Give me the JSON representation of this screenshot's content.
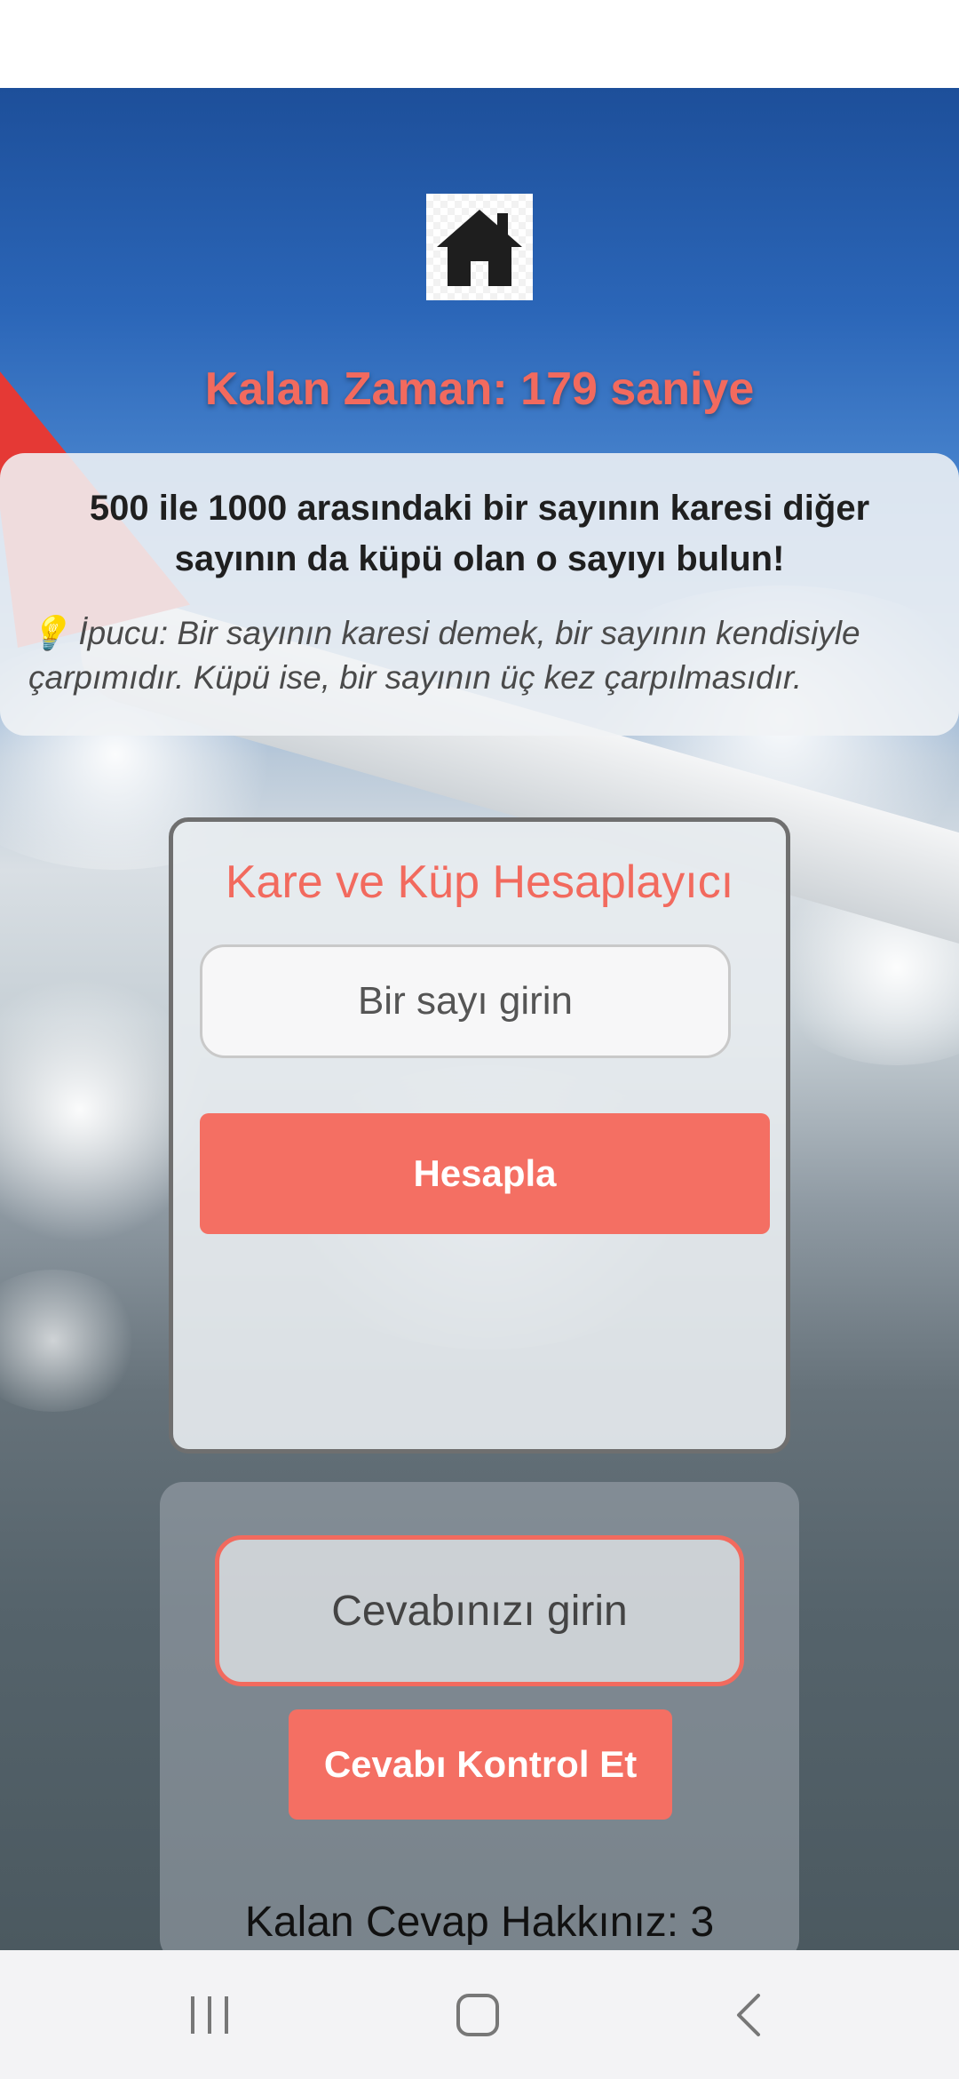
{
  "header": {
    "timer_text": "Kalan Zaman: 179 saniye"
  },
  "question": {
    "text": "500 ile 1000 arasındaki bir sayının karesi diğer sayının da küpü olan o sayıyı bulun!",
    "hint_icon": "💡",
    "hint": "İpucu: Bir sayının karesi demek, bir sayının kendisiyle çarpımıdır. Küpü ise, bir sayının üç kez çarpılmasıdır."
  },
  "calculator": {
    "title": "Kare ve Küp Hesaplayıcı",
    "input_placeholder": "Bir sayı girin",
    "input_value": "",
    "button_label": "Hesapla"
  },
  "answer": {
    "input_placeholder": "Cevabınızı girin",
    "input_value": "",
    "button_label": "Cevabı Kontrol Et",
    "attempts_text": "Kalan Cevap Hakkınız: 3"
  },
  "icons": {
    "home": "home-icon",
    "nav_recents": "recents-icon",
    "nav_home": "nav-home-icon",
    "nav_back": "back-icon"
  },
  "colors": {
    "accent": "#f46f63",
    "timer": "#f26a5e"
  }
}
